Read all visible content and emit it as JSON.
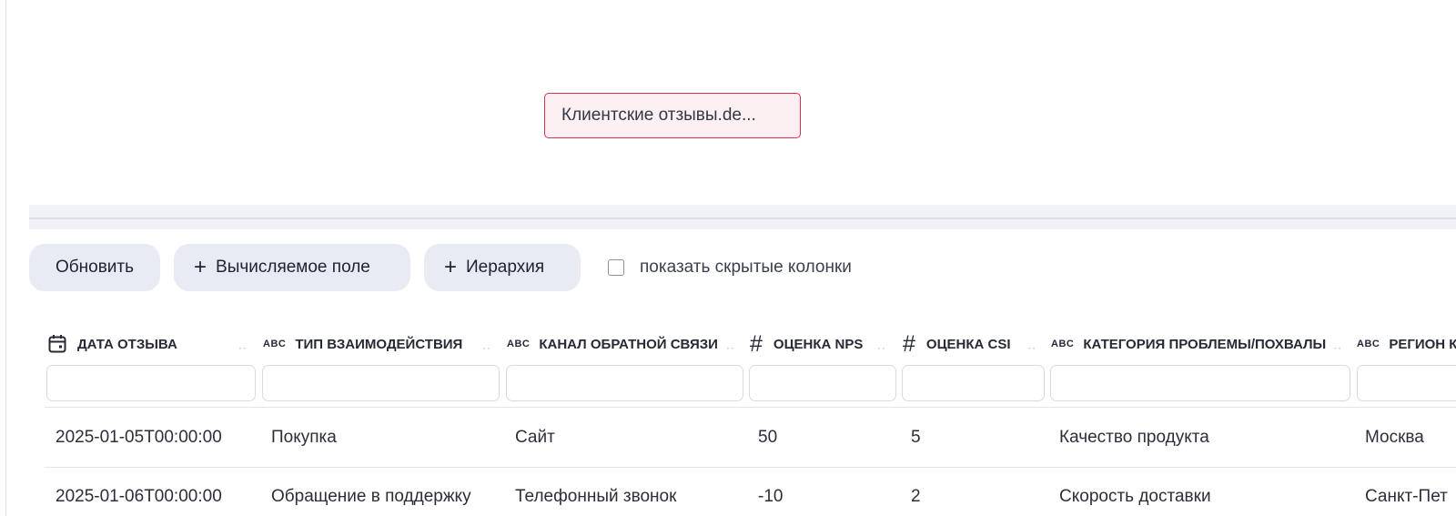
{
  "canvas": {
    "node_label": "Клиентские отзывы.de..."
  },
  "toolbar": {
    "refresh_label": "Обновить",
    "calc_field_label": "Вычисляемое поле",
    "hierarchy_label": "Иерархия",
    "show_hidden_label": "показать скрытые колонки",
    "show_hidden_checked": false
  },
  "table": {
    "type_badge_text": "ABC",
    "type_badge_number": "#",
    "columns": [
      {
        "label": "ДАТА ОТЗЫВА",
        "type": "date",
        "icon": "calendar-icon"
      },
      {
        "label": "ТИП ВЗАИМОДЕЙСТВИЯ",
        "type": "text"
      },
      {
        "label": "КАНАЛ ОБРАТНОЙ СВЯЗИ",
        "type": "text"
      },
      {
        "label": "ОЦЕНКА NPS",
        "type": "number"
      },
      {
        "label": "ОЦЕНКА CSI",
        "type": "number"
      },
      {
        "label": "КАТЕГОРИЯ ПРОБЛЕМЫ/ПОХВАЛЫ",
        "type": "text"
      },
      {
        "label": "РЕГИОН К",
        "type": "text"
      }
    ],
    "rows": [
      [
        "2025-01-05T00:00:00",
        "Покупка",
        "Сайт",
        "50",
        "5",
        "Качество продукта",
        "Москва"
      ],
      [
        "2025-01-06T00:00:00",
        "Обращение в поддержку",
        "Телефонный звонок",
        "-10",
        "2",
        "Скорость доставки",
        "Санкт-Пет"
      ]
    ]
  },
  "colors": {
    "node_border": "#d9314b",
    "node_fill": "#fdf0f2",
    "button_fill": "#e8ebf3"
  }
}
